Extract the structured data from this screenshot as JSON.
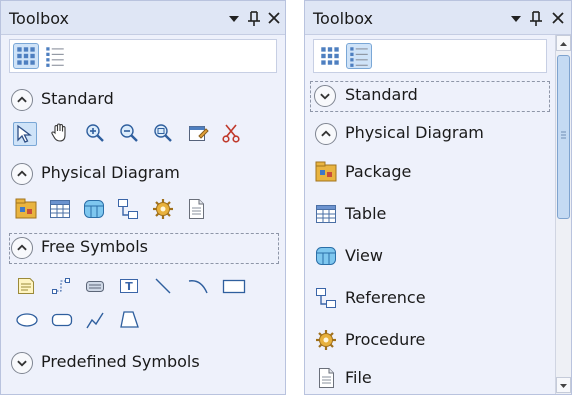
{
  "left_panel": {
    "title": "Toolbox",
    "groups": {
      "standard": "Standard",
      "physical_diagram": "Physical Diagram",
      "free_symbols": "Free Symbols",
      "predefined_symbols": "Predefined Symbols"
    },
    "view_mode": "icons",
    "standard_tools": [
      "pointer-icon",
      "grabber-hand-icon",
      "zoom-in-icon",
      "zoom-out-icon",
      "open-zoom-icon",
      "properties-icon",
      "delete-icon"
    ],
    "physical_tools": [
      "package-icon",
      "table-icon",
      "view-icon",
      "reference-icon",
      "procedure-icon",
      "file-icon"
    ],
    "free_symbol_tools": [
      "note-icon",
      "link-icon",
      "text-box-icon",
      "title-icon",
      "line-icon",
      "arc-icon",
      "rectangle-icon",
      "ellipse-icon",
      "rounded-rectangle-icon",
      "polyline-icon",
      "polygon-icon"
    ]
  },
  "right_panel": {
    "title": "Toolbox",
    "view_mode": "list",
    "groups": {
      "standard": "Standard",
      "physical_diagram": "Physical Diagram"
    },
    "items": [
      {
        "label": "Package",
        "icon": "package-icon"
      },
      {
        "label": "Table",
        "icon": "table-icon"
      },
      {
        "label": "View",
        "icon": "view-icon"
      },
      {
        "label": "Reference",
        "icon": "reference-icon"
      },
      {
        "label": "Procedure",
        "icon": "procedure-icon"
      },
      {
        "label": "File",
        "icon": "file-icon"
      }
    ]
  },
  "titlebar_buttons": {
    "dropdown": "▼",
    "pin": "ᵖ",
    "close": "✕"
  },
  "colors": {
    "panel_background": "#eef1fb",
    "selection": "#cfe3f8",
    "selection_border": "#7aa7d6",
    "title_background": "#dfe6f5"
  }
}
